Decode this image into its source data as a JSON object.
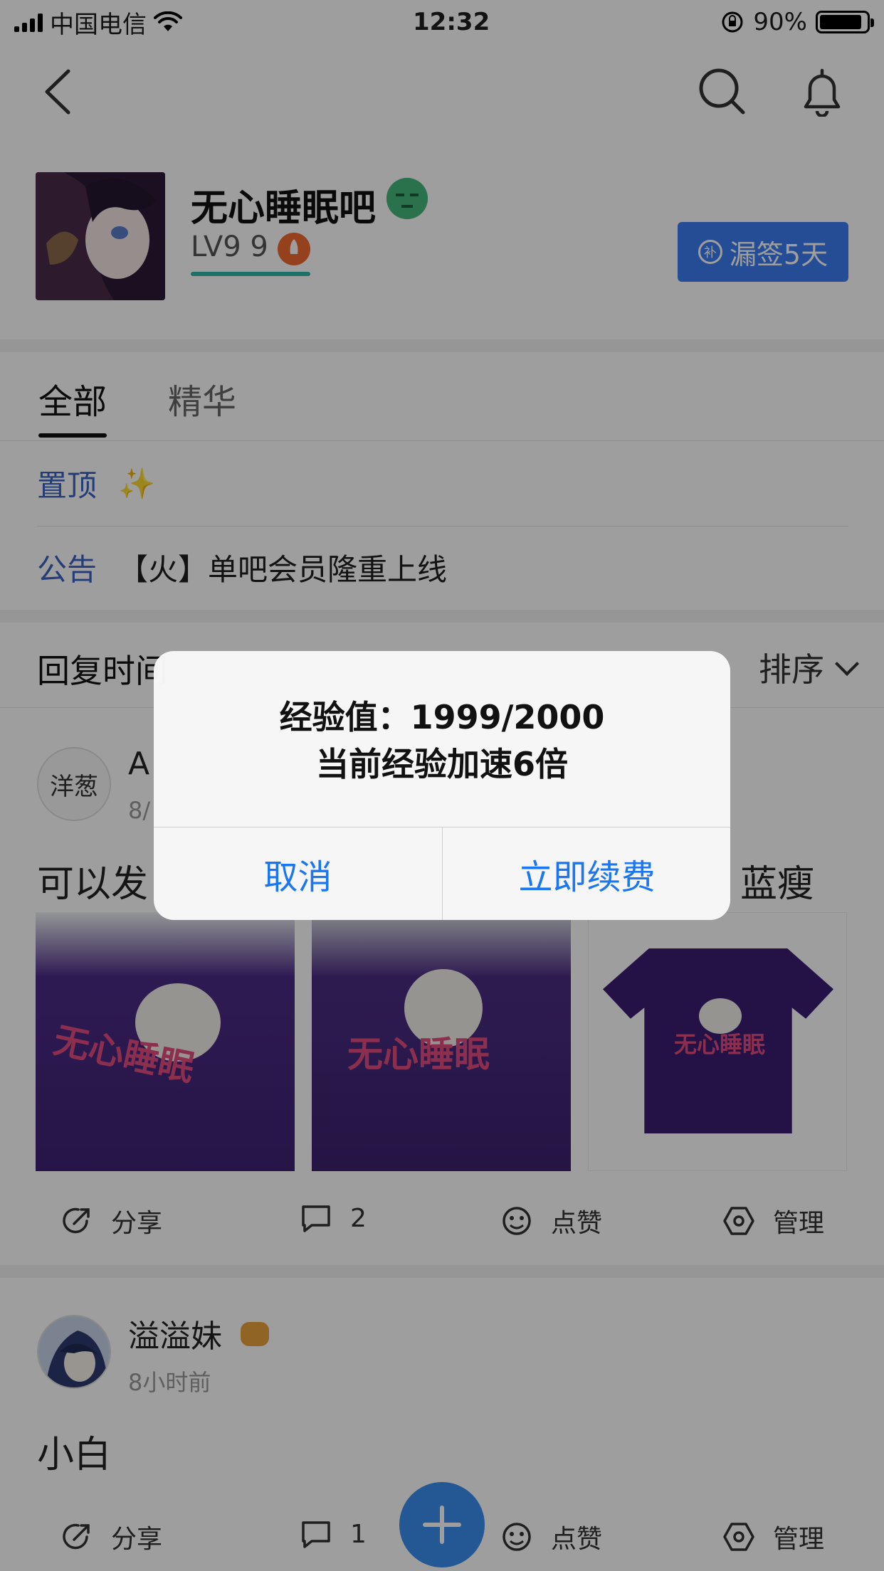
{
  "status_bar": {
    "carrier": "中国电信",
    "time": "12:32",
    "battery": "90%"
  },
  "nav": {
    "back_icon": "chevron-left-icon",
    "search_icon": "search-icon",
    "bell_icon": "bell-icon"
  },
  "forum": {
    "name": "无心睡眠吧",
    "level": "LV9 9",
    "signin_label": "漏签5天",
    "signin_icon_text": "补"
  },
  "tabs": [
    {
      "label": "全部",
      "active": true
    },
    {
      "label": "精华",
      "active": false
    }
  ],
  "pinned": {
    "label": "置顶",
    "emoji": "✨"
  },
  "notice": {
    "label": "公告",
    "text": "【火】单吧会员隆重上线"
  },
  "sort": {
    "left_label": "回复时间",
    "right_label": "排序"
  },
  "posts": [
    {
      "author_partial": "A",
      "avatar_text": "洋葱",
      "time_partial": "8/",
      "text_left": "可以发",
      "text_right": "蓝瘦",
      "shirt_text": "无心睡眠",
      "actions": {
        "share": "分享",
        "comments": "2",
        "like": "点赞",
        "manage": "管理"
      }
    },
    {
      "author": "溢溢妹",
      "time": "8小时前",
      "text": "小白",
      "actions": {
        "share": "分享",
        "comments": "1",
        "like": "点赞",
        "manage": "管理"
      }
    }
  ],
  "alert": {
    "line1": "经验值：1999/2000",
    "line2": "当前经验加速6倍",
    "cancel": "取消",
    "confirm": "立即续费"
  },
  "colors": {
    "accent_blue": "#3a7df0",
    "alert_button_blue": "#1a76f2",
    "link_blue": "#3a63c4"
  }
}
